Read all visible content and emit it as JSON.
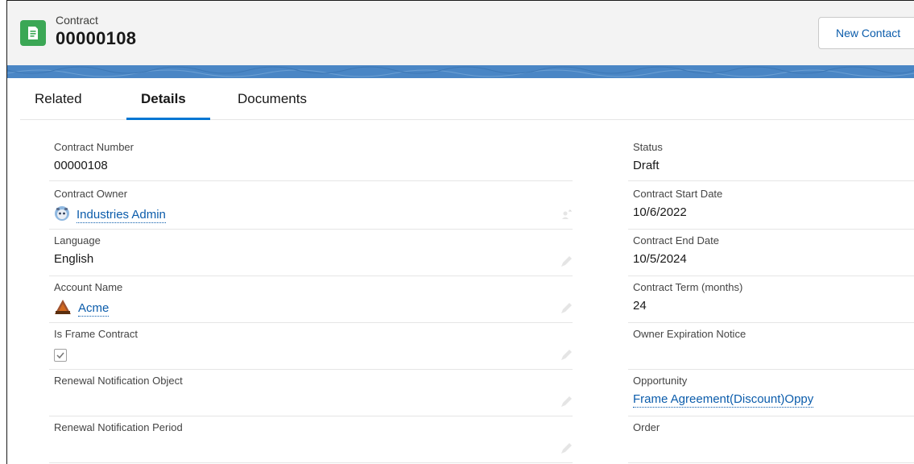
{
  "header": {
    "record_type": "Contract",
    "record_number": "00000108",
    "new_contact_label": "New Contact"
  },
  "tabs": [
    {
      "label": "Related"
    },
    {
      "label": "Details"
    },
    {
      "label": "Documents"
    }
  ],
  "active_tab": "Details",
  "fields_left": {
    "contract_number": {
      "label": "Contract Number",
      "value": "00000108"
    },
    "contract_owner": {
      "label": "Contract Owner",
      "value": "Industries Admin"
    },
    "language": {
      "label": "Language",
      "value": "English"
    },
    "account_name": {
      "label": "Account Name",
      "value": "Acme"
    },
    "is_frame_contract": {
      "label": "Is Frame Contract",
      "checked": true
    },
    "renewal_notification_object": {
      "label": "Renewal Notification Object",
      "value": ""
    },
    "renewal_notification_period": {
      "label": "Renewal Notification Period",
      "value": ""
    }
  },
  "fields_right": {
    "status": {
      "label": "Status",
      "value": "Draft"
    },
    "contract_start_date": {
      "label": "Contract Start Date",
      "value": "10/6/2022"
    },
    "contract_end_date": {
      "label": "Contract End Date",
      "value": "10/5/2024"
    },
    "contract_term": {
      "label": "Contract Term (months)",
      "value": "24"
    },
    "owner_expiration_notice": {
      "label": "Owner Expiration Notice",
      "value": ""
    },
    "opportunity": {
      "label": "Opportunity",
      "value": "Frame Agreement(Discount)Oppy"
    },
    "order": {
      "label": "Order",
      "value": ""
    }
  },
  "colors": {
    "record_icon": "#3ba755",
    "link": "#0b5cab",
    "tab_underline": "#0176d3",
    "band": "#4a86c5"
  }
}
